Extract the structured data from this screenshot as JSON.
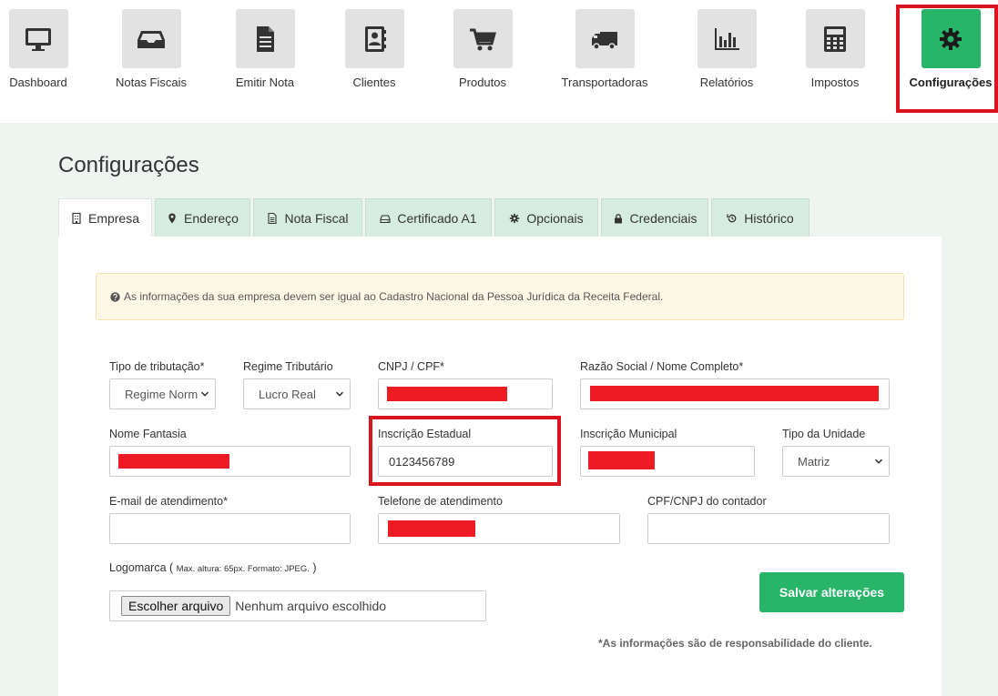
{
  "nav": {
    "items": [
      {
        "label": "Dashboard",
        "icon": "monitor-icon"
      },
      {
        "label": "Notas Fiscais",
        "icon": "inbox-icon"
      },
      {
        "label": "Emitir Nota",
        "icon": "document-icon"
      },
      {
        "label": "Clientes",
        "icon": "contact-book-icon"
      },
      {
        "label": "Produtos",
        "icon": "shopping-cart-icon"
      },
      {
        "label": "Transportadoras",
        "icon": "truck-icon"
      },
      {
        "label": "Relatórios",
        "icon": "bar-chart-icon"
      },
      {
        "label": "Impostos",
        "icon": "calculator-icon"
      },
      {
        "label": "Configurações",
        "icon": "gear-icon",
        "active": true
      }
    ]
  },
  "page": {
    "title": "Configurações"
  },
  "tabs": [
    {
      "label": "Empresa",
      "icon": "building-icon",
      "active": true
    },
    {
      "label": "Endereço",
      "icon": "map-marker-icon"
    },
    {
      "label": "Nota Fiscal",
      "icon": "file-text-icon"
    },
    {
      "label": "Certificado A1",
      "icon": "drive-icon"
    },
    {
      "label": "Opcionais",
      "icon": "gear-icon"
    },
    {
      "label": "Credenciais",
      "icon": "lock-icon"
    },
    {
      "label": "Histórico",
      "icon": "history-icon"
    }
  ],
  "alert": {
    "text": "As informações da sua empresa devem ser igual ao Cadastro Nacional da Pessoa Jurídica da Receita Federal."
  },
  "form": {
    "tipo_tributacao": {
      "label": "Tipo de tributação*",
      "value": "Regime Normal"
    },
    "regime_tributario": {
      "label": "Regime Tributário",
      "value": "Lucro Real"
    },
    "cnpj_cpf": {
      "label": "CNPJ / CPF*",
      "value": ""
    },
    "razao_social": {
      "label": "Razão Social / Nome Completo*",
      "value": ""
    },
    "nome_fantasia": {
      "label": "Nome Fantasia",
      "value": ""
    },
    "inscricao_estadual": {
      "label": "Inscrição Estadual",
      "value": "0123456789"
    },
    "inscricao_municipal": {
      "label": "Inscrição Municipal",
      "value": ""
    },
    "tipo_unidade": {
      "label": "Tipo da Unidade",
      "value": "Matriz"
    },
    "email": {
      "label": "E-mail de atendimento*",
      "value": ""
    },
    "telefone": {
      "label": "Telefone de atendimento",
      "value": ""
    },
    "cpf_contador": {
      "label": "CPF/CNPJ do contador",
      "value": ""
    },
    "logomarca": {
      "label": "Logomarca (",
      "hint": "Max. altura: 65px. Formato: JPEG.",
      "close": ")"
    },
    "file": {
      "button": "Escolher arquivo",
      "status": "Nenhum arquivo escolhido"
    }
  },
  "actions": {
    "save": "Salvar alterações"
  },
  "disclaimer": "*As informações são de responsabilidade do cliente.",
  "colors": {
    "accent": "#28b56a",
    "highlight": "#d9141f",
    "redaction": "#ed1c24"
  }
}
